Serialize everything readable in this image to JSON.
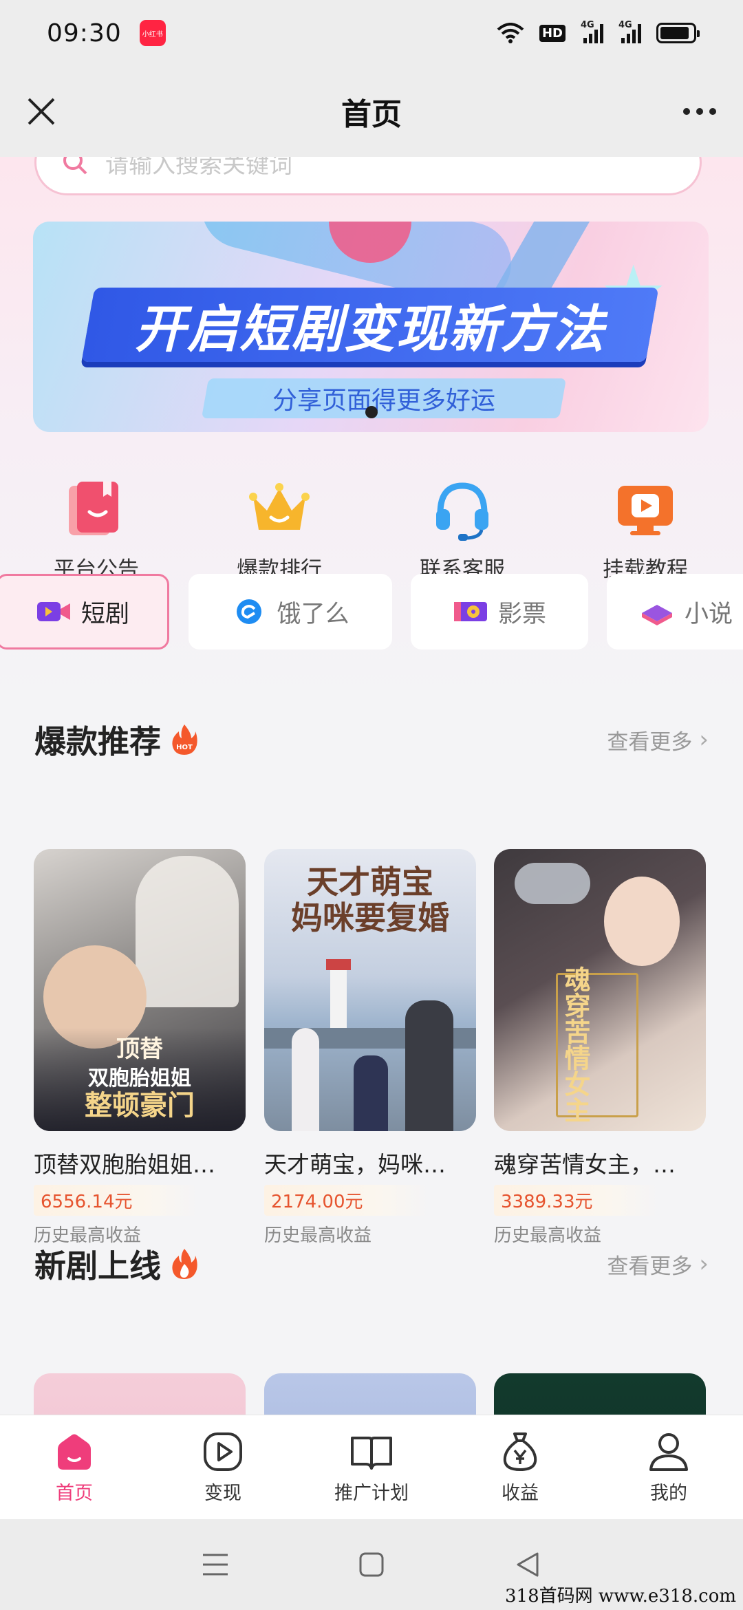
{
  "status_bar": {
    "time": "09:30",
    "app_badge": "小红书",
    "hd": "HD",
    "network_1": "4G",
    "network_2": "4G",
    "battery_level": 0.9
  },
  "title_bar": {
    "title": "首页",
    "close_icon": "close-icon",
    "more_icon": "more-dots-icon"
  },
  "search": {
    "placeholder": "请输入搜索关键词"
  },
  "banner": {
    "title": "开启短剧变现新方法",
    "subtitle": "分享页面得更多好运"
  },
  "quick_actions": [
    {
      "label": "平台公告",
      "icon": "bookmark-icon",
      "color": "#f0506e"
    },
    {
      "label": "爆款排行",
      "icon": "crown-icon",
      "color": "#f7b52c"
    },
    {
      "label": "联系客服",
      "icon": "headset-icon",
      "color": "#3aa4f2"
    },
    {
      "label": "挂载教程",
      "icon": "play-monitor-icon",
      "color": "#f4722b"
    }
  ],
  "category_tabs": [
    {
      "label": "短剧",
      "icon": "video-camera-icon",
      "active": true
    },
    {
      "label": "饿了么",
      "icon": "eleme-icon",
      "active": false
    },
    {
      "label": "影票",
      "icon": "film-ticket-icon",
      "active": false
    },
    {
      "label": "小说",
      "icon": "book-icon",
      "active": false
    }
  ],
  "hot_section": {
    "title": "爆款推荐",
    "hot_badge": "HOT",
    "see_more": "查看更多",
    "items": [
      {
        "title": "顶替双胞胎姐姐…",
        "amount": "6556.14元",
        "caption": "历史最高收益",
        "poster_text_1": "顶替",
        "poster_text_2": "双胞胎姐姐",
        "poster_text_3": "整顿豪门"
      },
      {
        "title": "天才萌宝，妈咪…",
        "amount": "2174.00元",
        "caption": "历史最高收益",
        "poster_text_1": "天才萌宝",
        "poster_text_2": "妈咪要复婚"
      },
      {
        "title": "魂穿苦情女主，…",
        "amount": "3389.33元",
        "caption": "历史最高收益",
        "poster_text_1": "魂穿苦情女主"
      }
    ]
  },
  "new_section": {
    "title": "新剧上线",
    "see_more": "查看更多"
  },
  "bottom_nav": [
    {
      "label": "首页",
      "icon": "home-icon",
      "active": true
    },
    {
      "label": "变现",
      "icon": "play-circle-icon",
      "active": false
    },
    {
      "label": "推广计划",
      "icon": "open-book-icon",
      "active": false
    },
    {
      "label": "收益",
      "icon": "money-bag-icon",
      "active": false
    },
    {
      "label": "我的",
      "icon": "user-icon",
      "active": false
    }
  ],
  "watermark": "318首码网 www.e318.com",
  "colors": {
    "accent": "#ef3d7b",
    "amount": "#e6542f"
  }
}
